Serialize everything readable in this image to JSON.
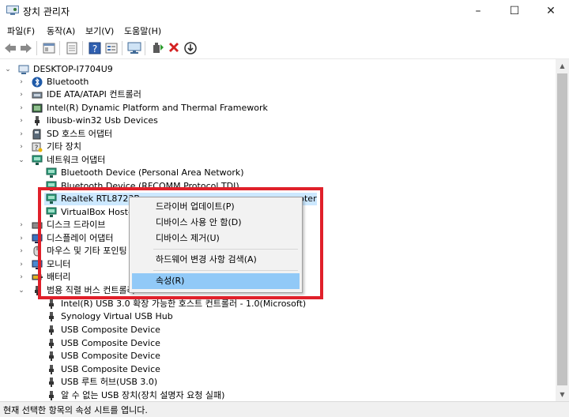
{
  "window": {
    "title": "장치 관리자",
    "minimize": "–",
    "maximize": "☐",
    "close": "✕"
  },
  "menu": [
    "파일(F)",
    "동작(A)",
    "보기(V)",
    "도움말(H)"
  ],
  "toolbar": {
    "icons": [
      "back-arrow-icon",
      "forward-arrow-icon",
      "properties-icon",
      "show-hidden-icon",
      "help-icon",
      "view-icon",
      "monitor-scan-icon",
      "add-driver-icon",
      "uninstall-x-icon",
      "update-driver-down-icon"
    ]
  },
  "tree": {
    "root": "DESKTOP-I7704U9",
    "items": [
      {
        "label": "Bluetooth"
      },
      {
        "label": "IDE ATA/ATAPI 컨트롤러"
      },
      {
        "label": "Intel(R) Dynamic Platform and Thermal Framework"
      },
      {
        "label": "libusb-win32 Usb Devices"
      },
      {
        "label": "SD 호스트 어댑터"
      },
      {
        "label": "기타 장치"
      },
      {
        "label": "네트워크 어댑터"
      },
      {
        "label": "Bluetooth Device (Personal Area Network)"
      },
      {
        "label": "Bluetooth Device (RFCOMM Protocol TDI)"
      },
      {
        "label": "Realtek RTL8723B",
        "suffix": "pter"
      },
      {
        "label": "VirtualBox Host-C"
      },
      {
        "label": "디스크 드라이브"
      },
      {
        "label": "디스플레이 어댑터"
      },
      {
        "label": "마우스 및 기타 포인팅"
      },
      {
        "label": "모니터"
      },
      {
        "label": "배터리"
      },
      {
        "label": "범용 직렬 버스 컨트롤러"
      },
      {
        "label": "Intel(R) USB 3.0 확장 가능한 호스트 컨트롤러 - 1.0(Microsoft)"
      },
      {
        "label": "Synology Virtual USB Hub"
      },
      {
        "label": "USB Composite Device"
      },
      {
        "label": "USB Composite Device"
      },
      {
        "label": "USB Composite Device"
      },
      {
        "label": "USB Composite Device"
      },
      {
        "label": "USB 루트 허브(USB 3.0)"
      },
      {
        "label": "알 수 없는 USB 장치(장치 설명자 요청 실패)"
      }
    ]
  },
  "context_menu": {
    "items": [
      "드라이버 업데이트(P)",
      "디바이스 사용 안 함(D)",
      "디바이스 제거(U)",
      "하드웨어 변경 사항 검색(A)",
      "속성(R)"
    ]
  },
  "status": "현재 선택한 항목의 속성 시트를 엽니다.",
  "colors": {
    "highlight": "#91c9f7",
    "selection": "#cce8ff",
    "annotation": "#e0202a"
  }
}
